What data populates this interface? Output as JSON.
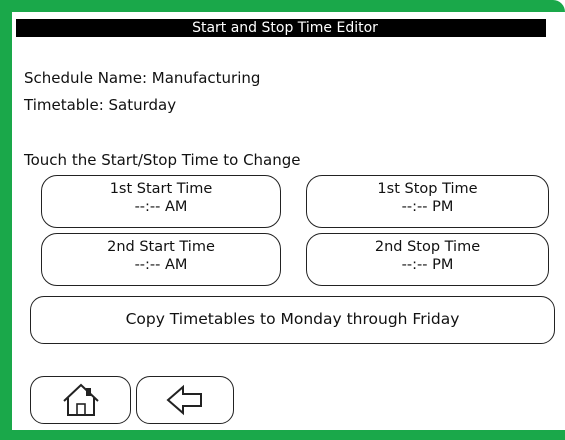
{
  "window": {
    "title": "Start and Stop Time Editor"
  },
  "info": {
    "schedule_name": "Schedule Name: Manufacturing",
    "timetable": "Timetable: Saturday",
    "instruction": "Touch the Start/Stop Time to Change"
  },
  "times": [
    {
      "label": "1st Start Time",
      "value": "--:-- AM"
    },
    {
      "label": "1st Stop Time",
      "value": "--:-- PM"
    },
    {
      "label": "2nd Start Time",
      "value": "--:-- AM"
    },
    {
      "label": "2nd Stop Time",
      "value": "--:-- PM"
    }
  ],
  "copy_button": {
    "label": "Copy Timetables to Monday through Friday"
  },
  "nav": {
    "home_icon": "home-icon",
    "back_icon": "back-arrow-icon"
  },
  "colors": {
    "frame": "#1aa84a",
    "title_bg": "#000000",
    "title_fg": "#ffffff"
  }
}
